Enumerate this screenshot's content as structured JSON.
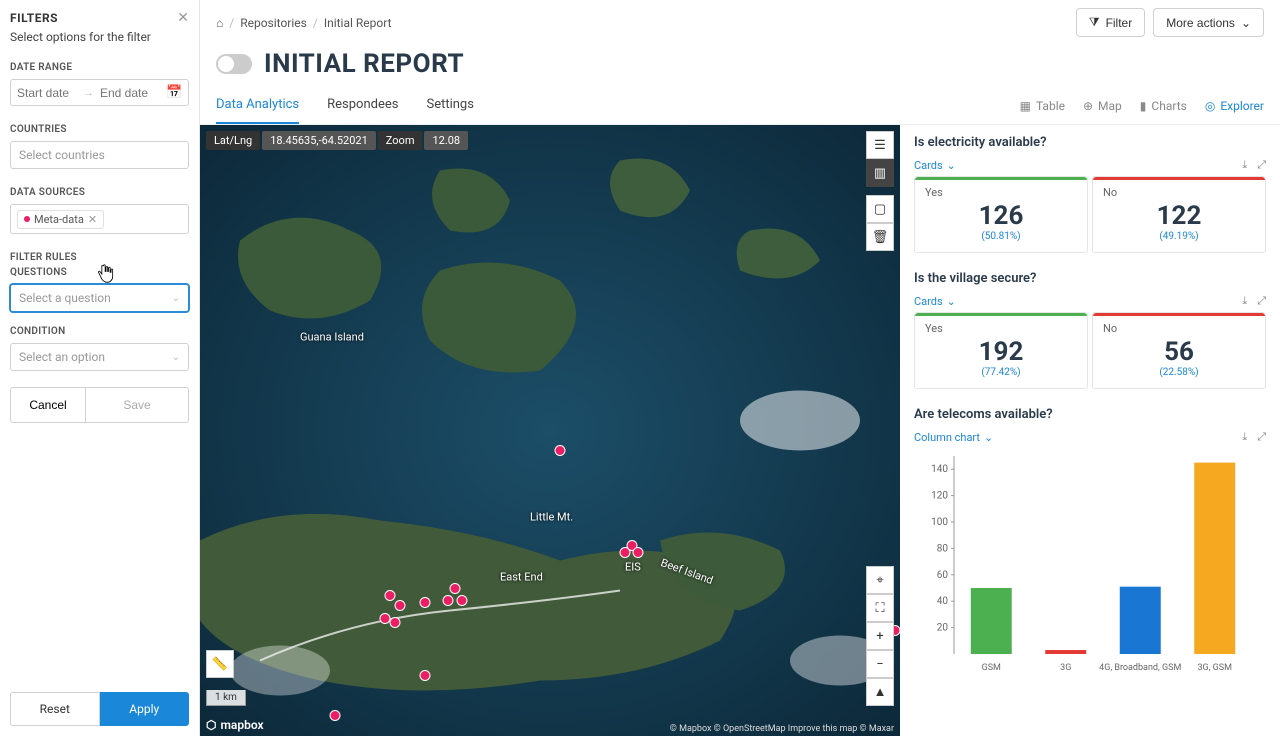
{
  "sidebar": {
    "title": "FILTERS",
    "subtitle": "Select options for the filter",
    "labels": {
      "date_range": "DATE RANGE",
      "start_ph": "Start date",
      "end_ph": "End date",
      "countries": "COUNTRIES",
      "countries_ph": "Select countries",
      "data_sources": "DATA SOURCES",
      "filter_rules": "FILTER RULES",
      "questions": "QUESTIONS",
      "question_ph": "Select a question",
      "condition": "CONDITION",
      "condition_ph": "Select an option"
    },
    "data_source_tag": "Meta-data",
    "cancel": "Cancel",
    "save": "Save",
    "reset": "Reset",
    "apply": "Apply"
  },
  "breadcrumb": {
    "home_icon": "⌂",
    "repositories": "Repositories",
    "current": "Initial Report"
  },
  "header": {
    "filter_btn": "Filter",
    "more_btn": "More actions",
    "title": "INITIAL REPORT"
  },
  "tabs": [
    "Data Analytics",
    "Respondees",
    "Settings"
  ],
  "viewops": {
    "table": "Table",
    "map": "Map",
    "charts": "Charts",
    "explorer": "Explorer"
  },
  "map": {
    "latlng_label": "Lat/Lng",
    "latlng_val": "18.45635,-64.52021",
    "zoom_label": "Zoom",
    "zoom_val": "12.08",
    "labels": [
      "Guana Island",
      "Little Mt.",
      "East End",
      "EIS",
      "Beef Island"
    ],
    "scale": "1 km",
    "logo": "mapbox",
    "attrib": "© Mapbox © OpenStreetMap Improve this map © Maxar"
  },
  "panels": [
    {
      "question": "Is electricity available?",
      "viz": "Cards",
      "stats": [
        {
          "label": "Yes",
          "value": "126",
          "pct": "(50.81%)",
          "color": "green"
        },
        {
          "label": "No",
          "value": "122",
          "pct": "(49.19%)",
          "color": "red"
        }
      ]
    },
    {
      "question": "Is the village secure?",
      "viz": "Cards",
      "stats": [
        {
          "label": "Yes",
          "value": "192",
          "pct": "(77.42%)",
          "color": "green"
        },
        {
          "label": "No",
          "value": "56",
          "pct": "(22.58%)",
          "color": "red"
        }
      ]
    },
    {
      "question": "Are telecoms available?",
      "viz": "Column chart"
    }
  ],
  "chart_data": {
    "type": "bar",
    "categories": [
      "GSM",
      "3G",
      "4G, Broadband, GSM",
      "3G, GSM"
    ],
    "values": [
      50,
      3,
      51,
      145
    ],
    "colors": [
      "#4caf50",
      "#e53935",
      "#1976d2",
      "#f6a821"
    ],
    "ylabel": "",
    "ylim": [
      0,
      150
    ],
    "yticks": [
      20,
      40,
      60,
      80,
      100,
      120,
      140
    ]
  }
}
